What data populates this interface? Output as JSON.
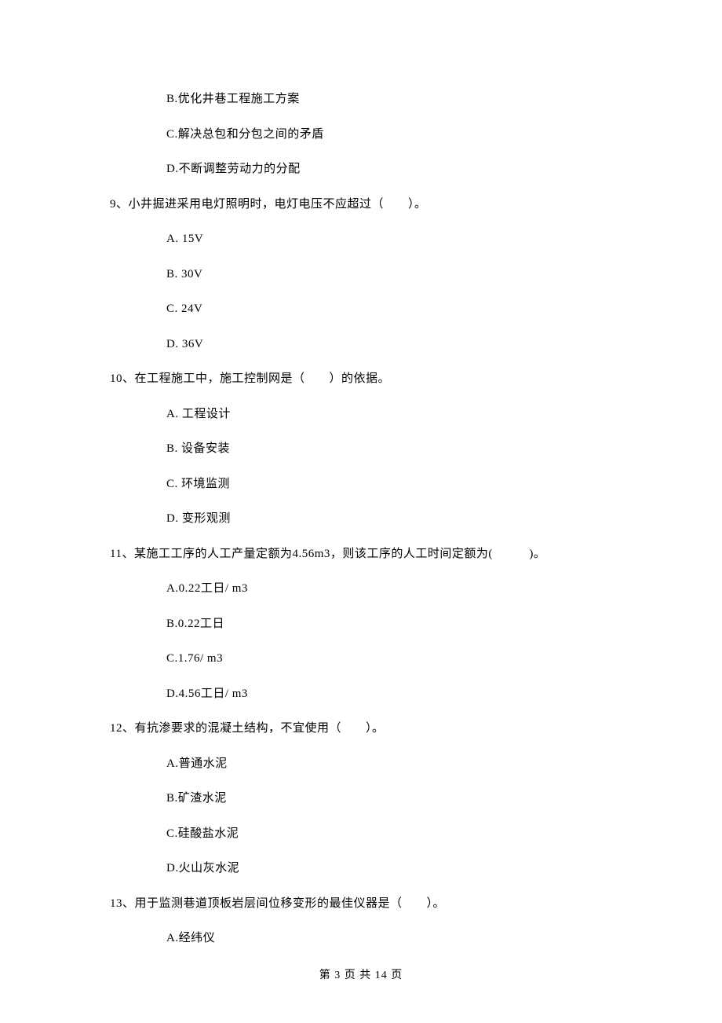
{
  "options_pre": [
    "B.优化井巷工程施工方案",
    "C.解决总包和分包之间的矛盾",
    "D.不断调整劳动力的分配"
  ],
  "q9": {
    "stem": "9、小井掘进采用电灯照明时，电灯电压不应超过（　　）。",
    "opts": [
      "A.  15V",
      "B.  30V",
      "C.  24V",
      "D.  36V"
    ]
  },
  "q10": {
    "stem": "10、在工程施工中，施工控制网是（　　）的依据。",
    "opts": [
      "A.  工程设计",
      "B.  设备安装",
      "C.  环境监测",
      "D.  变形观测"
    ]
  },
  "q11": {
    "stem": "11、某施工工序的人工产量定额为4.56m3，则该工序的人工时间定额为(　　　)。",
    "opts": [
      "A.0.22工日/ m3",
      "B.0.22工日",
      "C.1.76/ m3",
      "D.4.56工日/ m3"
    ]
  },
  "q12": {
    "stem": "12、有抗渗要求的混凝土结构，不宜使用（　　）。",
    "opts": [
      "A.普通水泥",
      "B.矿渣水泥",
      "C.硅酸盐水泥",
      "D.火山灰水泥"
    ]
  },
  "q13": {
    "stem": "13、用于监测巷道顶板岩层间位移变形的最佳仪器是（　　）。",
    "opts": [
      "A.经纬仪"
    ]
  },
  "footer": "第 3 页 共 14 页"
}
